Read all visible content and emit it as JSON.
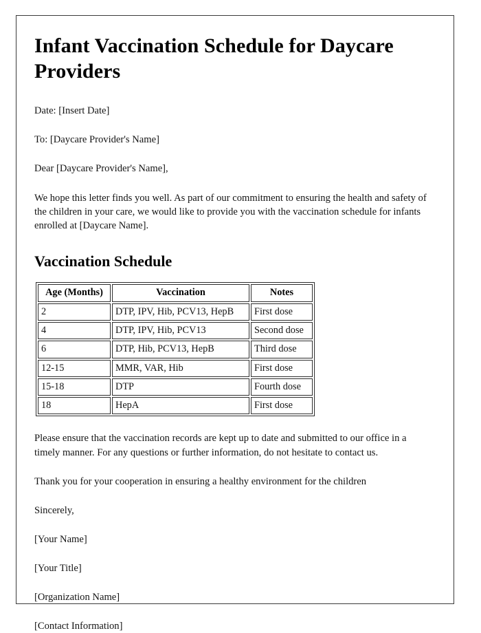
{
  "document": {
    "title": "Infant Vaccination Schedule for Daycare Providers",
    "date_line": "Date: [Insert Date]",
    "to_line": "To: [Daycare Provider's Name]",
    "salutation": "Dear [Daycare Provider's Name],",
    "intro_paragraph": "We hope this letter finds you well. As part of our commitment to ensuring the health and safety of the children in your care, we would like to provide you with the vaccination schedule for infants enrolled at [Daycare Name].",
    "section_heading": "Vaccination Schedule",
    "closing_paragraph": "Please ensure that the vaccination records are kept up to date and submitted to our office in a timely manner. For any questions or further information, do not hesitate to contact us.",
    "thanks_paragraph": "Thank you for your cooperation in ensuring a healthy environment for the children",
    "sign_off": "Sincerely,",
    "signature": {
      "name": "[Your Name]",
      "job_title": "[Your Title]",
      "organization": "[Organization Name]",
      "contact": "[Contact Information]"
    }
  },
  "schedule_table": {
    "headers": [
      "Age (Months)",
      "Vaccination",
      "Notes"
    ],
    "rows": [
      {
        "age": "2",
        "vaccination": "DTP, IPV, Hib, PCV13, HepB",
        "notes": "First dose"
      },
      {
        "age": "4",
        "vaccination": "DTP, IPV, Hib, PCV13",
        "notes": "Second dose"
      },
      {
        "age": "6",
        "vaccination": "DTP, Hib, PCV13, HepB",
        "notes": "Third dose"
      },
      {
        "age": "12-15",
        "vaccination": "MMR, VAR, Hib",
        "notes": "First dose"
      },
      {
        "age": "15-18",
        "vaccination": "DTP",
        "notes": "Fourth dose"
      },
      {
        "age": "18",
        "vaccination": "HepA",
        "notes": "First dose"
      }
    ]
  },
  "colors": {
    "page_border": "#3a3a3a",
    "table_border": "#2c2c2c",
    "text": "#141414",
    "heading": "#000000",
    "background": "#ffffff"
  }
}
